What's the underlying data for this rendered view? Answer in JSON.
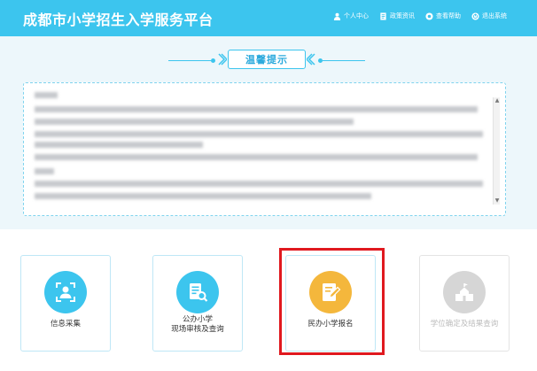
{
  "header": {
    "title": "成都市小学招生入学服务平台",
    "nav": [
      {
        "label": "个人中心",
        "icon": "person-icon"
      },
      {
        "label": "政策资讯",
        "icon": "document-icon"
      },
      {
        "label": "查看帮助",
        "icon": "help-icon"
      },
      {
        "label": "退出系统",
        "icon": "power-icon"
      }
    ]
  },
  "notice": {
    "title": "温馨提示"
  },
  "cards": [
    {
      "label_line1": "信息采集",
      "label_line2": "",
      "icon": "user-scan-icon",
      "color": "#3cc5ee",
      "enabled": true
    },
    {
      "label_line1": "公办小学",
      "label_line2": "现场审核及查询",
      "icon": "document-search-icon",
      "color": "#3cc5ee",
      "enabled": true
    },
    {
      "label_line1": "民办小学报名",
      "label_line2": "",
      "icon": "edit-document-icon",
      "color": "#f4b73c",
      "enabled": true
    },
    {
      "label_line1": "学位确定及结果查询",
      "label_line2": "",
      "icon": "school-icon",
      "color": "#d6d6d6",
      "enabled": false
    }
  ],
  "colors": {
    "header_bg": "#3cc5ee",
    "accent": "#3cc5ee",
    "highlight": "#e0191f"
  }
}
